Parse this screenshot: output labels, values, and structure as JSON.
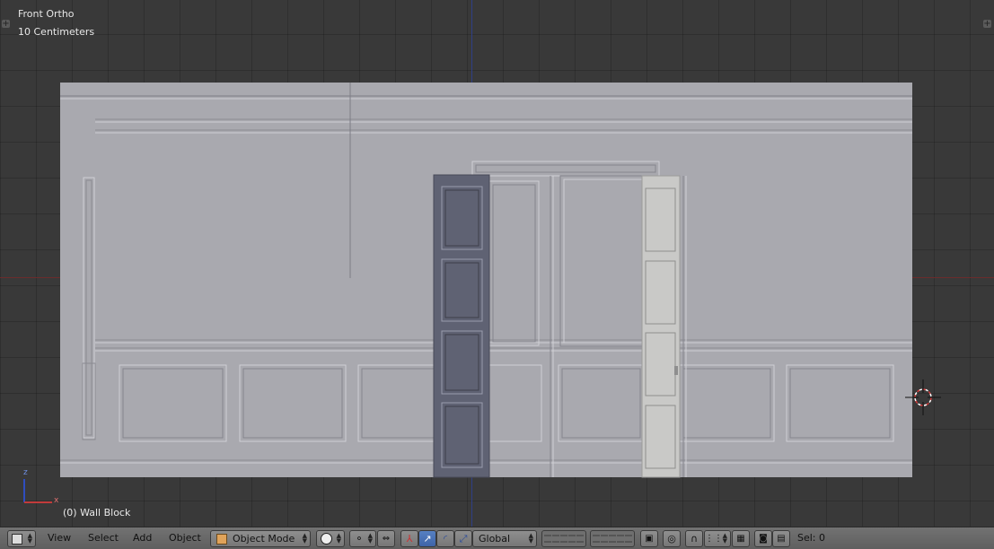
{
  "viewport": {
    "view_name": "Front Ortho",
    "scale_label": "10 Centimeters",
    "active_object": "(0) Wall Block",
    "axis_labels": {
      "z": "z",
      "x": "x"
    }
  },
  "header": {
    "editor_type_icon": "3d-view-icon",
    "menus": [
      "View",
      "Select",
      "Add",
      "Object"
    ],
    "mode": "Object Mode",
    "transform_orientation": "Global",
    "selection_count": "Sel: 0"
  },
  "colors": {
    "wall": "#a9a9af",
    "door_selected": "#5f6273",
    "door_open": "#c9c9c7",
    "axis_blue": "#2f3f86",
    "axis_red": "#6b2c2c",
    "header_active": "#5680c2"
  }
}
